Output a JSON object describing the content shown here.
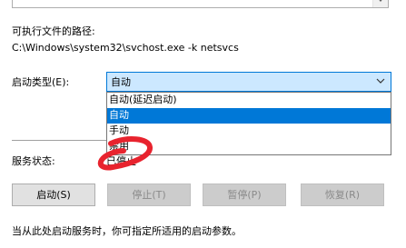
{
  "description": {
    "scroll_icon": "chevron-down-icon"
  },
  "path": {
    "label": "可执行文件的路径:",
    "value": "C:\\Windows\\system32\\svchost.exe -k netsvcs"
  },
  "startup_type": {
    "label": "启动类型(E):",
    "selected": "自动",
    "options": [
      "自动(延迟启动)",
      "自动",
      "手动",
      "禁用"
    ],
    "highlighted_index": 1
  },
  "service_status": {
    "label": "服务状态:",
    "value": "已停止"
  },
  "buttons": {
    "start": "启动(S)",
    "stop": "停止(T)",
    "pause": "暂停(P)",
    "resume": "恢复(R)"
  },
  "hint": "当从此处启动服务时，你可指定所适用的启动参数。",
  "colors": {
    "accent": "#0078d7",
    "combo_fill": "#cce8ff",
    "annotation": "#e8232e"
  }
}
